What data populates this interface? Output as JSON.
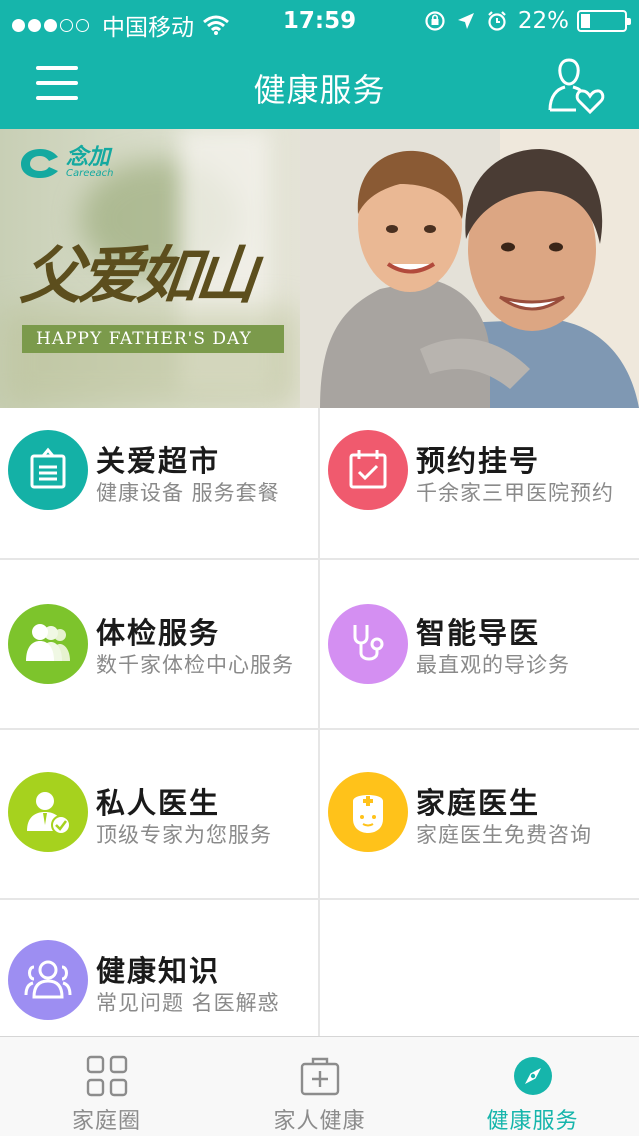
{
  "status_bar": {
    "carrier": "中国移动",
    "time": "17:59",
    "battery": "22%",
    "battery_level": 0.22,
    "signal_bars": 3
  },
  "nav": {
    "title": "健康服务"
  },
  "banner": {
    "brand_name": "念加",
    "brand_sub": "Careeach",
    "slogan": "父爱如山",
    "tagline": "HAPPY FATHER'S DAY"
  },
  "services": [
    {
      "title": "关爱超市",
      "subtitle": "健康设备 服务套餐",
      "icon": "clipboard-icon",
      "color": "#14b1a6"
    },
    {
      "title": "预约挂号",
      "subtitle": "千余家三甲医院预约",
      "icon": "calendar-check-icon",
      "color": "#f05a6e"
    },
    {
      "title": "体检服务",
      "subtitle": "数千家体检中心服务",
      "icon": "group-icon",
      "color": "#7dc42c"
    },
    {
      "title": "智能导医",
      "subtitle": "最直观的导诊务",
      "icon": "stethoscope-icon",
      "color": "#d48ff2"
    },
    {
      "title": "私人医生",
      "subtitle": "顶级专家为您服务",
      "icon": "doctor-check-icon",
      "color": "#a6d21e"
    },
    {
      "title": "家庭医生",
      "subtitle": "家庭医生免费咨询",
      "icon": "nurse-icon",
      "color": "#ffc21a"
    },
    {
      "title": "健康知识",
      "subtitle": "常见问题 名医解惑",
      "icon": "people-icon",
      "color": "#9d8ef2"
    }
  ],
  "tabs": [
    {
      "label": "家庭圈",
      "icon": "grid-icon",
      "active": false
    },
    {
      "label": "家人健康",
      "icon": "medical-kit-icon",
      "active": false
    },
    {
      "label": "健康服务",
      "icon": "compass-icon",
      "active": true
    }
  ],
  "colors": {
    "primary": "#16b5ab",
    "tab_inactive": "#8c8c8c"
  }
}
